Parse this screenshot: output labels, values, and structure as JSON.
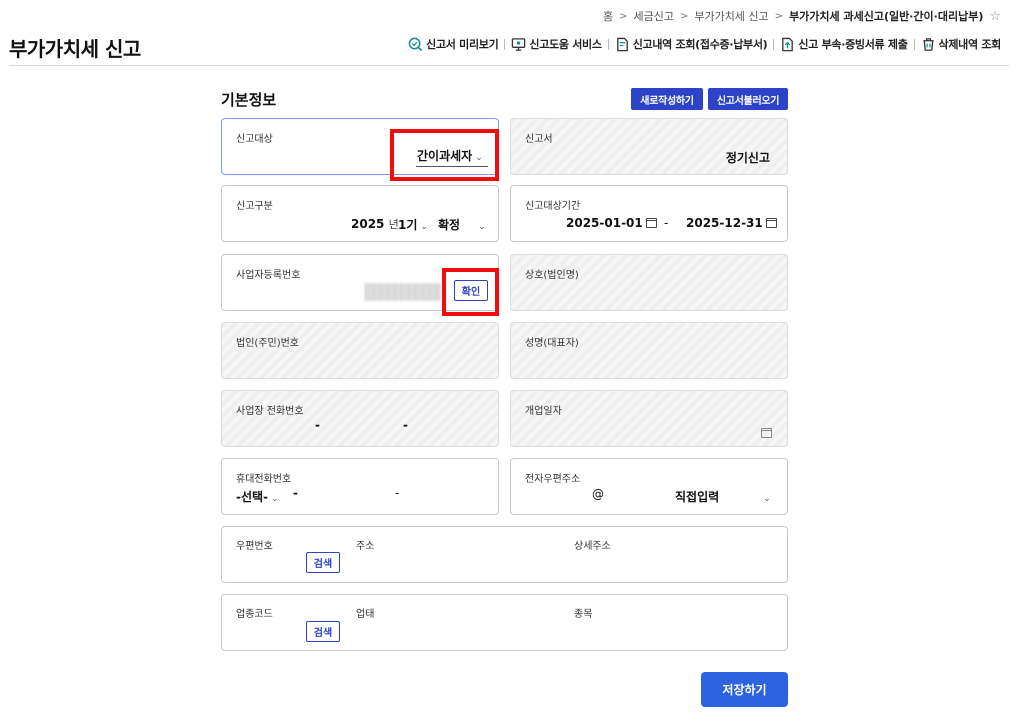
{
  "breadcrumb": {
    "home": "홈",
    "level1": "세금신고",
    "level2": "부가가치세 신고",
    "current": "부가가치세 과세신고(일반·간이·대리납부)",
    "separator": ">"
  },
  "page_title": "부가가치세 신고",
  "top_menu": {
    "preview": "신고서 미리보기",
    "help": "신고도움 서비스",
    "history": "신고내역 조회(접수증·납부서)",
    "attachments": "신고 부속·증빙서류 제출",
    "deleted": "삭제내역 조회"
  },
  "section": {
    "title": "기본정보",
    "new_button": "새로작성하기",
    "load_button": "신고서불러오기"
  },
  "fields": {
    "target": {
      "label": "신고대상",
      "value": "간이과세자"
    },
    "form": {
      "label": "신고서",
      "value": "정기신고"
    },
    "category": {
      "label": "신고구분",
      "year": "2025",
      "year_unit": "년",
      "period": "1기",
      "type": "확정"
    },
    "period_range": {
      "label": "신고대상기간",
      "start": "2025-01-01",
      "dash": "-",
      "end": "2025-12-31"
    },
    "biz_no": {
      "label": "사업자등록번호",
      "confirm": "확인"
    },
    "company": {
      "label": "상호(법인명)"
    },
    "corp_no": {
      "label": "법인(주민)번호"
    },
    "rep_name": {
      "label": "성명(대표자)"
    },
    "biz_phone": {
      "label": "사업장 전화번호",
      "dash": "-"
    },
    "open_date": {
      "label": "개업일자"
    },
    "mobile": {
      "label": "휴대전화번호",
      "select": "-선택-",
      "dash": "-"
    },
    "email": {
      "label": "전자우편주소",
      "at": "@",
      "domain": "직접입력"
    },
    "address": {
      "zip_label": "우편번호",
      "addr_label": "주소",
      "detail_label": "상세주소",
      "search": "검색"
    },
    "industry": {
      "code_label": "업종코드",
      "type_label": "업태",
      "item_label": "종목",
      "search": "검색"
    }
  },
  "save_button": "저장하기",
  "colors": {
    "primary": "#2d44c9",
    "save": "#2d63e0",
    "highlight": "#f20c0c"
  }
}
